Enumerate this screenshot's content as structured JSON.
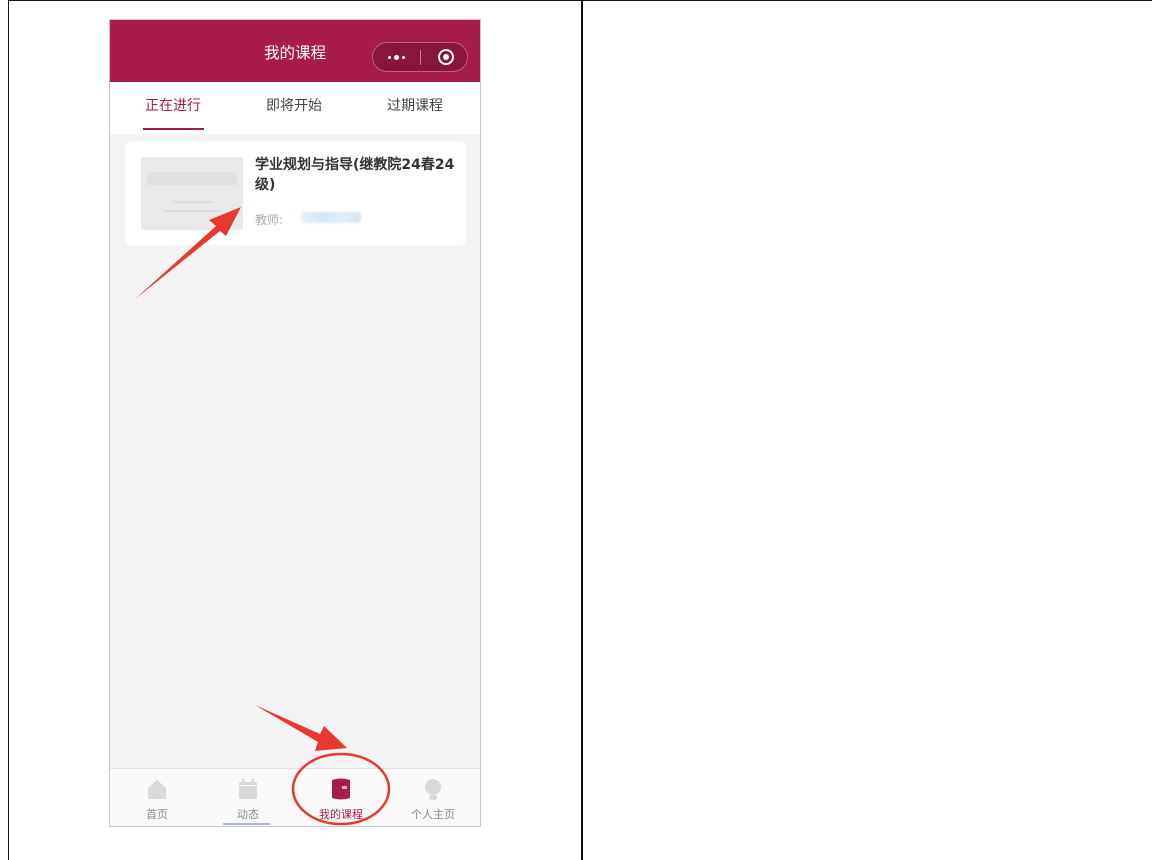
{
  "app": {
    "title": "我的课程"
  },
  "tabs": [
    {
      "label": "正在进行",
      "active": true
    },
    {
      "label": "即将开始",
      "active": false
    },
    {
      "label": "过期课程",
      "active": false
    }
  ],
  "course": {
    "title": "学业规划与指导(继教院24春24级)",
    "teacher_label": "教师:"
  },
  "tabbar": [
    {
      "label": "首页",
      "icon": "home-icon",
      "active": false
    },
    {
      "label": "动态",
      "icon": "calendar-icon",
      "active": false
    },
    {
      "label": "我的课程",
      "icon": "book-icon",
      "active": true
    },
    {
      "label": "个人主页",
      "icon": "person-icon",
      "active": false
    }
  ],
  "colors": {
    "brand": "#a71c4a",
    "annotation": "#e8382f"
  }
}
